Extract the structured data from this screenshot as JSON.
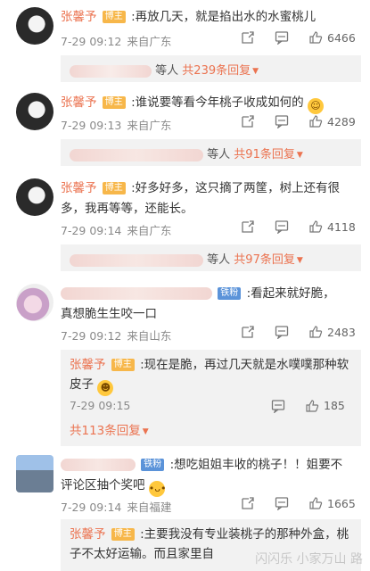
{
  "comments": [
    {
      "name": "张馨予",
      "badge": "博主",
      "text": ":再放几天，就是掐出水的水蜜桃儿",
      "time": "7-29 09:12",
      "location": "来自广东",
      "likes": "6466",
      "reply_suffix": "等人",
      "reply_more": "共239条回复"
    },
    {
      "name": "张馨予",
      "badge": "博主",
      "text": ":谁说要等看今年桃子收成如何的",
      "time": "7-29 09:13",
      "location": "来自广东",
      "likes": "4289",
      "reply_suffix": "等人",
      "reply_more": "共91条回复"
    },
    {
      "name": "张馨予",
      "badge": "博主",
      "text_line1": ":好多好多，这只摘了两筐，树上还有很",
      "text_line2": "多，我再等等，还能长。",
      "time": "7-29 09:14",
      "location": "来自广东",
      "likes": "4118",
      "reply_suffix": "等人",
      "reply_more": "共97条回复"
    },
    {
      "badge": "铁粉",
      "text_line1": ":看起来就好脆，",
      "text_line2": "真想脆生生咬一口",
      "time": "7-29 09:12",
      "location": "来自山东",
      "likes": "2483",
      "sub_reply": {
        "name": "张馨予",
        "badge": "博主",
        "text_line1": ":现在是脆，再过几天就是水噗噗那种软",
        "text_line2": "皮子",
        "time": "7-29 09:15",
        "likes": "185"
      },
      "reply_more": "共113条回复"
    },
    {
      "badge": "铁粉",
      "text_line1": ":想吃姐姐丰收的桃子！！姐要不",
      "text_line2": "评论区抽个奖吧",
      "time": "7-29 09:14",
      "location": "来自福建",
      "likes": "1665",
      "sub_reply": {
        "name": "张馨予",
        "badge": "博主",
        "text_line1": ":主要我没有专业装桃子的那种外盒，桃",
        "text_line2": "子不太好运输。而且家里自"
      }
    }
  ],
  "watermark": "闪闪乐 小家万山 路"
}
